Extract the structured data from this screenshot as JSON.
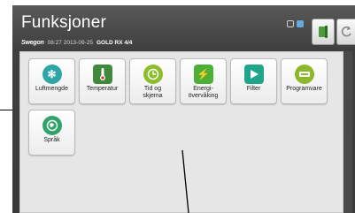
{
  "header": {
    "title": "Funksjoner",
    "brand": "Swegon",
    "datetime": "08:27 2013-09-25",
    "model": "GOLD RX 4/4",
    "status_icons": [
      "network-icon",
      "user-icon"
    ],
    "home_icon": "home-icon",
    "back_icon": "back-arrow-icon"
  },
  "tiles": [
    {
      "label": "Luftmengde",
      "icon": "fan-icon",
      "color": "#2fa6a6"
    },
    {
      "label": "Temperatur",
      "icon": "thermometer-icon",
      "color": "#3f8a3a"
    },
    {
      "label": "Tid og\nskjema",
      "icon": "clock-icon",
      "color": "#8bbf2a"
    },
    {
      "label": "Energi-\növervåking",
      "icon": "energy-icon",
      "color": "#4caf36"
    },
    {
      "label": "Filter",
      "icon": "filter-icon",
      "color": "#1fa58a"
    },
    {
      "label": "Programvare",
      "icon": "software-icon",
      "color": "#8cb82b"
    },
    {
      "label": "Språk",
      "icon": "globe-icon",
      "color": "#31a36a"
    }
  ]
}
